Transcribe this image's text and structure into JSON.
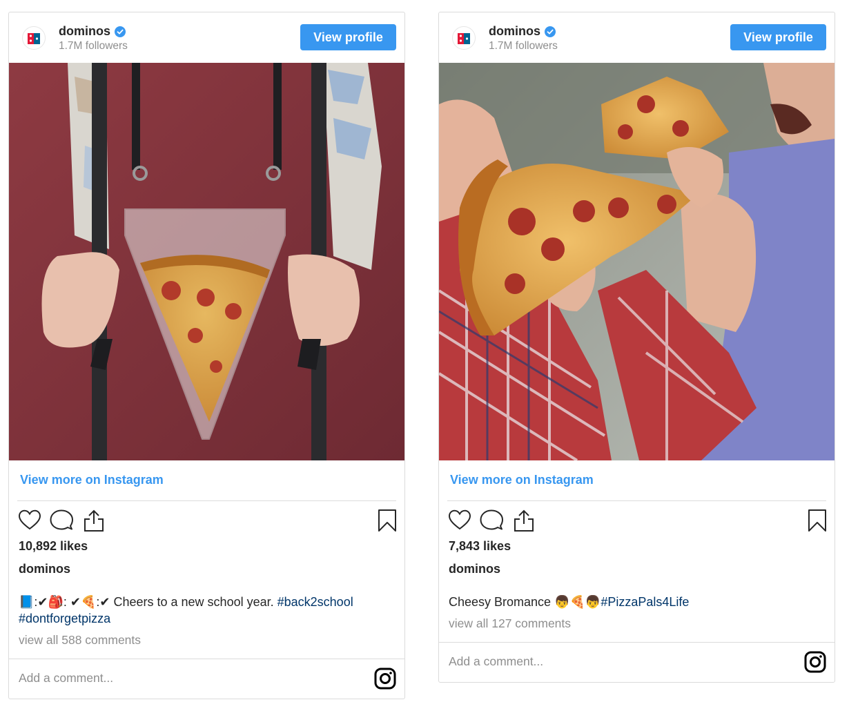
{
  "posts": [
    {
      "username": "dominos",
      "followers": "1.7M followers",
      "view_profile_label": "View profile",
      "view_more_label": "View more on Instagram",
      "likes": "10,892 likes",
      "caption_user": "dominos",
      "caption_prefix": "📘:✔🎒: ✔🍕:✔ Cheers to a new school year. ",
      "tag1": "#back2school",
      "tag2": "#dontforgetpizza",
      "view_all_comments": "view all 588 comments",
      "add_comment_placeholder": "Add a comment..."
    },
    {
      "username": "dominos",
      "followers": "1.7M followers",
      "view_profile_label": "View profile",
      "view_more_label": "View more on Instagram",
      "likes": "7,843 likes",
      "caption_user": "dominos",
      "caption_prefix": "Cheesy Bromance 👦🍕👦",
      "tag1": "#PizzaPals4Life",
      "view_all_comments": "view all 127 comments",
      "add_comment_placeholder": "Add a comment..."
    }
  ],
  "icons": [
    "verified-badge-icon",
    "heart-icon",
    "comment-icon",
    "share-icon",
    "bookmark-icon",
    "instagram-icon"
  ],
  "colors": {
    "accent": "#3897f0",
    "hashtag": "#003569",
    "muted": "#8e8e8e",
    "border": "#dbdbdb"
  }
}
